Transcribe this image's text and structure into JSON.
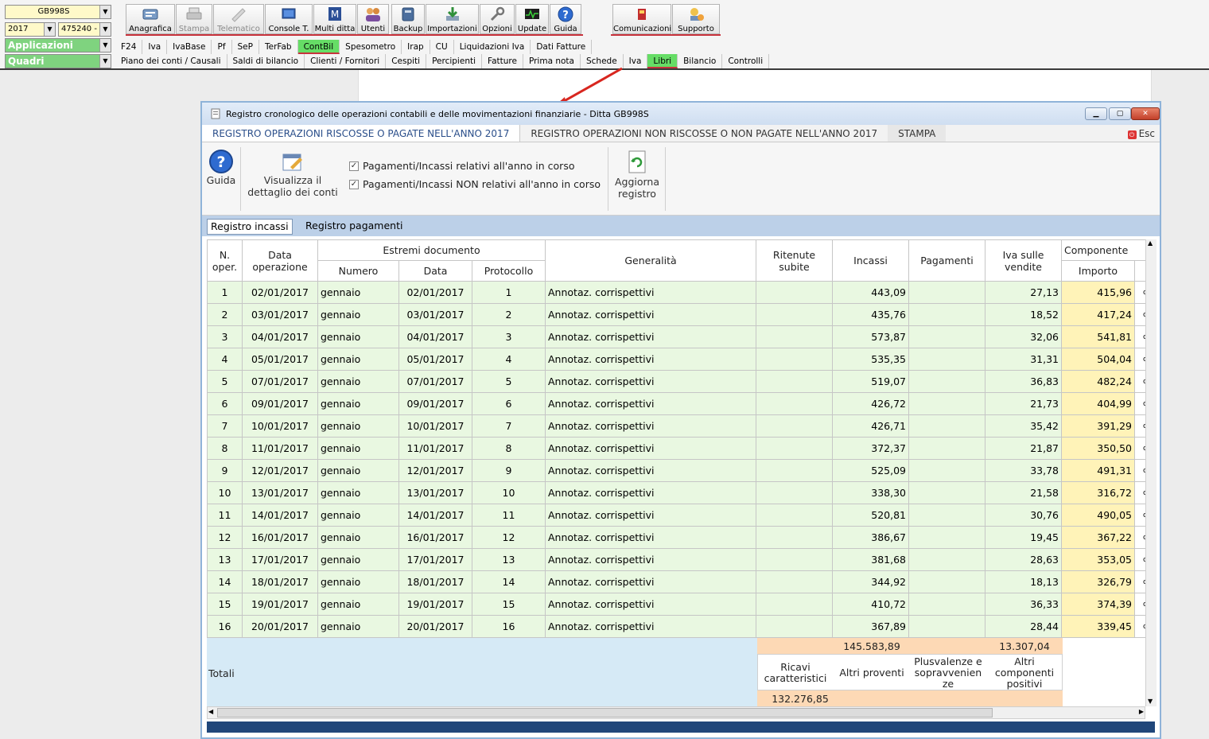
{
  "app": {
    "company_code": "GB998S",
    "year": "2017",
    "client_code": "475240 -",
    "applicazioni_label": "Applicazioni",
    "quadri_label": "Quadri"
  },
  "toolbar": [
    {
      "label": "Anagrafica",
      "icon": "anagrafica-icon",
      "enabled": true
    },
    {
      "label": "Stampa",
      "icon": "printer-icon",
      "enabled": false
    },
    {
      "label": "Telematico",
      "icon": "telematico-icon",
      "enabled": false
    },
    {
      "label": "Console T.",
      "icon": "console-icon",
      "enabled": true
    },
    {
      "label": "Multi ditta",
      "icon": "multi-ditta-icon",
      "enabled": true
    },
    {
      "label": "Utenti",
      "icon": "users-icon",
      "enabled": true
    },
    {
      "label": "Backup",
      "icon": "backup-icon",
      "enabled": true
    },
    {
      "label": "Importazioni",
      "icon": "download-icon",
      "enabled": true
    },
    {
      "label": "Opzioni",
      "icon": "wrench-icon",
      "enabled": true
    },
    {
      "label": "Update",
      "icon": "update-icon",
      "enabled": true
    },
    {
      "label": "Guida",
      "icon": "help-icon",
      "enabled": true
    },
    {
      "label": "Comunicazioni",
      "icon": "comunicazioni-icon",
      "enabled": true
    },
    {
      "label": "Supporto",
      "icon": "support-icon",
      "enabled": true
    }
  ],
  "menu1": [
    "F24",
    "Iva",
    "IvaBase",
    "Pf",
    "SeP",
    "TerFab",
    "ContBil",
    "Spesometro",
    "Irap",
    "CU",
    "Liquidazioni Iva",
    "Dati Fatture"
  ],
  "menu1_selected": "ContBil",
  "menu2": [
    "Piano dei conti / Causali",
    "Saldi di bilancio",
    "Clienti / Fornitori",
    "Cespiti",
    "Percipienti",
    "Fatture",
    "Prima nota",
    "Schede",
    "Iva",
    "Libri",
    "Bilancio",
    "Controlli"
  ],
  "menu2_selected": "Libri",
  "dialog": {
    "title": "Registro cronologico delle operazioni contabili e delle movimentazioni finanziarie - Ditta GB998S",
    "tabs": [
      "REGISTRO OPERAZIONI RISCOSSE O PAGATE NELL'ANNO 2017",
      "REGISTRO OPERAZIONI NON RISCOSSE O NON PAGATE NELL'ANNO 2017",
      "STAMPA"
    ],
    "esc_label": "Esc",
    "ribbon": {
      "guida": "Guida",
      "visualizza_line1": "Visualizza il",
      "visualizza_line2": "dettaglio dei conti",
      "check1": "Pagamenti/Incassi relativi all'anno in corso",
      "check2": "Pagamenti/Incassi NON relativi all'anno in corso",
      "aggiorna_line1": "Aggiorna",
      "aggiorna_line2": "registro"
    },
    "subtabs": [
      "Registro incassi",
      "Registro pagamenti"
    ]
  },
  "grid": {
    "headers": {
      "n_oper_1": "N.",
      "n_oper_2": "oper.",
      "data_op_1": "Data",
      "data_op_2": "operazione",
      "estremi": "Estremi documento",
      "numero": "Numero",
      "data": "Data",
      "protocollo": "Protocollo",
      "generalita": "Generalità",
      "ritenute_1": "Ritenute",
      "ritenute_2": "subite",
      "incassi": "Incassi",
      "pagamenti": "Pagamenti",
      "iva_1": "Iva sulle",
      "iva_2": "vendite",
      "componente": "Componente",
      "importo": "Importo"
    },
    "rows": [
      {
        "n": "1",
        "data_op": "02/01/2017",
        "numero": "gennaio",
        "data": "02/01/2017",
        "prot": "1",
        "gen": "Annotaz. corrispettivi",
        "incassi": "443,09",
        "iva": "27,13",
        "importo": "415,96"
      },
      {
        "n": "2",
        "data_op": "03/01/2017",
        "numero": "gennaio",
        "data": "03/01/2017",
        "prot": "2",
        "gen": "Annotaz. corrispettivi",
        "incassi": "435,76",
        "iva": "18,52",
        "importo": "417,24"
      },
      {
        "n": "3",
        "data_op": "04/01/2017",
        "numero": "gennaio",
        "data": "04/01/2017",
        "prot": "3",
        "gen": "Annotaz. corrispettivi",
        "incassi": "573,87",
        "iva": "32,06",
        "importo": "541,81"
      },
      {
        "n": "4",
        "data_op": "05/01/2017",
        "numero": "gennaio",
        "data": "05/01/2017",
        "prot": "4",
        "gen": "Annotaz. corrispettivi",
        "incassi": "535,35",
        "iva": "31,31",
        "importo": "504,04"
      },
      {
        "n": "5",
        "data_op": "07/01/2017",
        "numero": "gennaio",
        "data": "07/01/2017",
        "prot": "5",
        "gen": "Annotaz. corrispettivi",
        "incassi": "519,07",
        "iva": "36,83",
        "importo": "482,24"
      },
      {
        "n": "6",
        "data_op": "09/01/2017",
        "numero": "gennaio",
        "data": "09/01/2017",
        "prot": "6",
        "gen": "Annotaz. corrispettivi",
        "incassi": "426,72",
        "iva": "21,73",
        "importo": "404,99"
      },
      {
        "n": "7",
        "data_op": "10/01/2017",
        "numero": "gennaio",
        "data": "10/01/2017",
        "prot": "7",
        "gen": "Annotaz. corrispettivi",
        "incassi": "426,71",
        "iva": "35,42",
        "importo": "391,29"
      },
      {
        "n": "8",
        "data_op": "11/01/2017",
        "numero": "gennaio",
        "data": "11/01/2017",
        "prot": "8",
        "gen": "Annotaz. corrispettivi",
        "incassi": "372,37",
        "iva": "21,87",
        "importo": "350,50"
      },
      {
        "n": "9",
        "data_op": "12/01/2017",
        "numero": "gennaio",
        "data": "12/01/2017",
        "prot": "9",
        "gen": "Annotaz. corrispettivi",
        "incassi": "525,09",
        "iva": "33,78",
        "importo": "491,31"
      },
      {
        "n": "10",
        "data_op": "13/01/2017",
        "numero": "gennaio",
        "data": "13/01/2017",
        "prot": "10",
        "gen": "Annotaz. corrispettivi",
        "incassi": "338,30",
        "iva": "21,58",
        "importo": "316,72"
      },
      {
        "n": "11",
        "data_op": "14/01/2017",
        "numero": "gennaio",
        "data": "14/01/2017",
        "prot": "11",
        "gen": "Annotaz. corrispettivi",
        "incassi": "520,81",
        "iva": "30,76",
        "importo": "490,05"
      },
      {
        "n": "12",
        "data_op": "16/01/2017",
        "numero": "gennaio",
        "data": "16/01/2017",
        "prot": "12",
        "gen": "Annotaz. corrispettivi",
        "incassi": "386,67",
        "iva": "19,45",
        "importo": "367,22"
      },
      {
        "n": "13",
        "data_op": "17/01/2017",
        "numero": "gennaio",
        "data": "17/01/2017",
        "prot": "13",
        "gen": "Annotaz. corrispettivi",
        "incassi": "381,68",
        "iva": "28,63",
        "importo": "353,05"
      },
      {
        "n": "14",
        "data_op": "18/01/2017",
        "numero": "gennaio",
        "data": "18/01/2017",
        "prot": "14",
        "gen": "Annotaz. corrispettivi",
        "incassi": "344,92",
        "iva": "18,13",
        "importo": "326,79"
      },
      {
        "n": "15",
        "data_op": "19/01/2017",
        "numero": "gennaio",
        "data": "19/01/2017",
        "prot": "15",
        "gen": "Annotaz. corrispettivi",
        "incassi": "410,72",
        "iva": "36,33",
        "importo": "374,39"
      },
      {
        "n": "16",
        "data_op": "20/01/2017",
        "numero": "gennaio",
        "data": "20/01/2017",
        "prot": "16",
        "gen": "Annotaz. corrispettivi",
        "incassi": "367,89",
        "iva": "28,44",
        "importo": "339,45"
      }
    ],
    "stub_char": "c"
  },
  "totals": {
    "label": "Totali",
    "incassi_total": "145.583,89",
    "iva_total": "13.307,04",
    "ricavi_label_1": "Ricavi",
    "ricavi_label_2": "caratteristici",
    "altri_proventi_label": "Altri proventi",
    "plusvalenze_1": "Plusvalenze e",
    "plusvalenze_2": "sopravvenien",
    "plusvalenze_3": "ze",
    "altri_comp_1": "Altri",
    "altri_comp_2": "componenti",
    "altri_comp_3": "positivi",
    "ricavi_value": "132.276,85"
  },
  "colors": {
    "row_green": "#e9f8e1",
    "component_yellow": "#fff3b8",
    "totals_orange": "#fdd9b5",
    "totals_blue": "#d6eaf6",
    "selected_menu": "#66dd66",
    "accent_red": "#c8323c"
  }
}
